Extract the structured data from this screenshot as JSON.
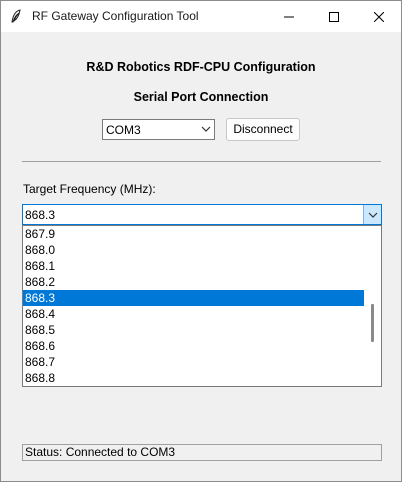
{
  "window": {
    "title": "RF Gateway Configuration Tool"
  },
  "main": {
    "heading": "R&D Robotics RDF-CPU Configuration",
    "subheading": "Serial Port Connection",
    "port_select": {
      "value": "COM3"
    },
    "disconnect_label": "Disconnect",
    "frequency_label": "Target Frequency (MHz):",
    "frequency_select": {
      "value": "868.3"
    },
    "frequency_options": [
      "867.9",
      "868.0",
      "868.1",
      "868.2",
      "868.3",
      "868.4",
      "868.5",
      "868.6",
      "868.7",
      "868.8"
    ],
    "selected_option": "868.3"
  },
  "status": {
    "text": "Status: Connected to COM3"
  },
  "colors": {
    "accent": "#0078d7",
    "titlebar_bg": "#ffffff",
    "client_bg": "#f0f0f0"
  }
}
